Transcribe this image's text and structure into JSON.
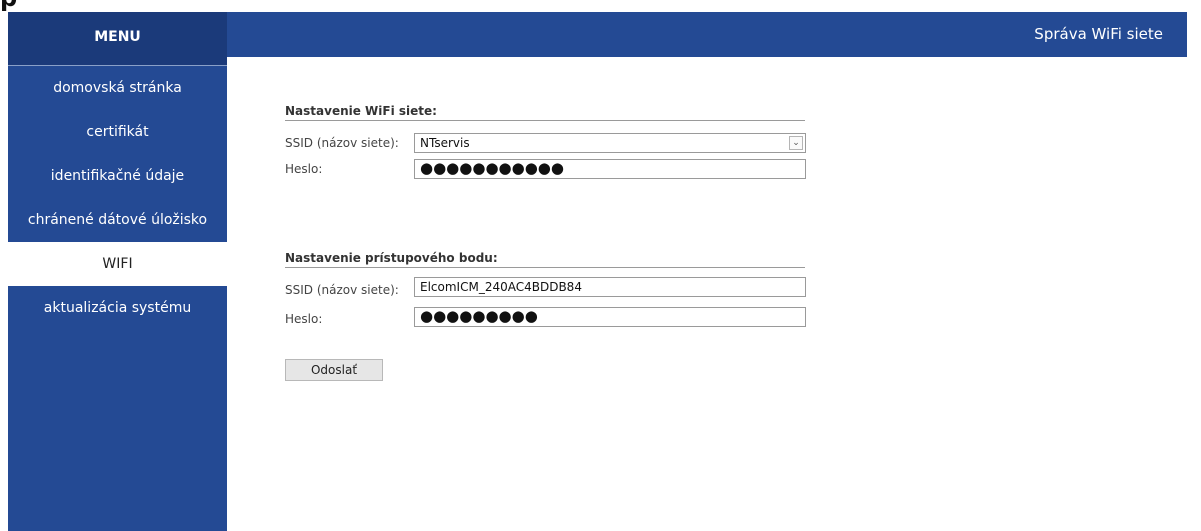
{
  "menu": {
    "title": "MENU",
    "items": [
      {
        "label": "domovská stránka",
        "active": false
      },
      {
        "label": "certifikát",
        "active": false
      },
      {
        "label": "identifikačné údaje",
        "active": false
      },
      {
        "label": "chránené dátové úložisko",
        "active": false
      },
      {
        "label": "WIFI",
        "active": true
      },
      {
        "label": "aktualizácia systému",
        "active": false
      }
    ]
  },
  "header": {
    "title": "Správa WiFi siete"
  },
  "wifi": {
    "section_title": "Nastavenie WiFi siete:",
    "ssid_label": "SSID (názov siete):",
    "ssid_value": "NTservis",
    "password_label": "Heslo:",
    "password_value": "●●●●●●●●●●●"
  },
  "ap": {
    "section_title": "Nastavenie prístupového bodu:",
    "ssid_label": "SSID (názov siete):",
    "ssid_value": "ElcomICM_240AC4BDDB84",
    "password_label": "Heslo:",
    "password_value": "●●●●●●●●●"
  },
  "submit_label": "Odoslať",
  "colors": {
    "sidebar": "#244a94",
    "menu_header": "#1b3a7a",
    "active_item": "#ffffff"
  }
}
